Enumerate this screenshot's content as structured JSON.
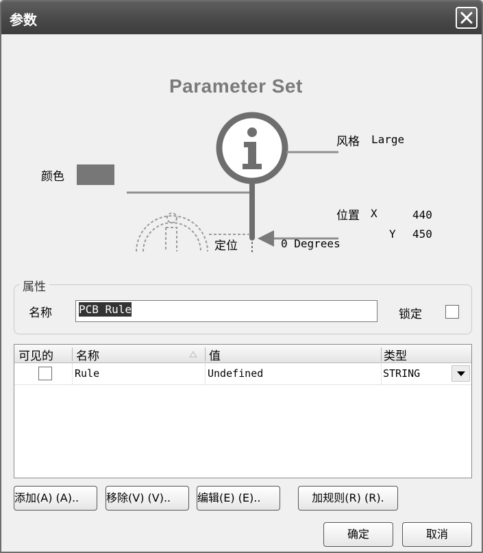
{
  "window": {
    "title": "参数"
  },
  "illustration": {
    "heading": "Parameter Set",
    "color_label": "颜色",
    "color_value": "#777777",
    "style_label": "风格",
    "style_value": "Large",
    "position_label": "位置",
    "x_label": "X",
    "x_value": "440",
    "y_label": "Y",
    "y_value": "450",
    "orientation_label": "定位",
    "orientation_value": "0 Degrees"
  },
  "properties": {
    "group_title": "属性",
    "name_label": "名称",
    "name_value": "PCB Rule",
    "lock_label": "锁定",
    "lock_checked": false
  },
  "grid": {
    "headers": {
      "visible": "可见的",
      "name": "名称",
      "value": "值",
      "type": "类型"
    },
    "rows": [
      {
        "visible": false,
        "name": "Rule",
        "value": "Undefined",
        "type": "STRING"
      }
    ]
  },
  "buttons": {
    "add": "添加(A) (A)..",
    "remove": "移除(V) (V)..",
    "edit": "编辑(E) (E)..",
    "add_rule": "加规则(R) (R).",
    "ok": "确定",
    "cancel": "取消"
  }
}
